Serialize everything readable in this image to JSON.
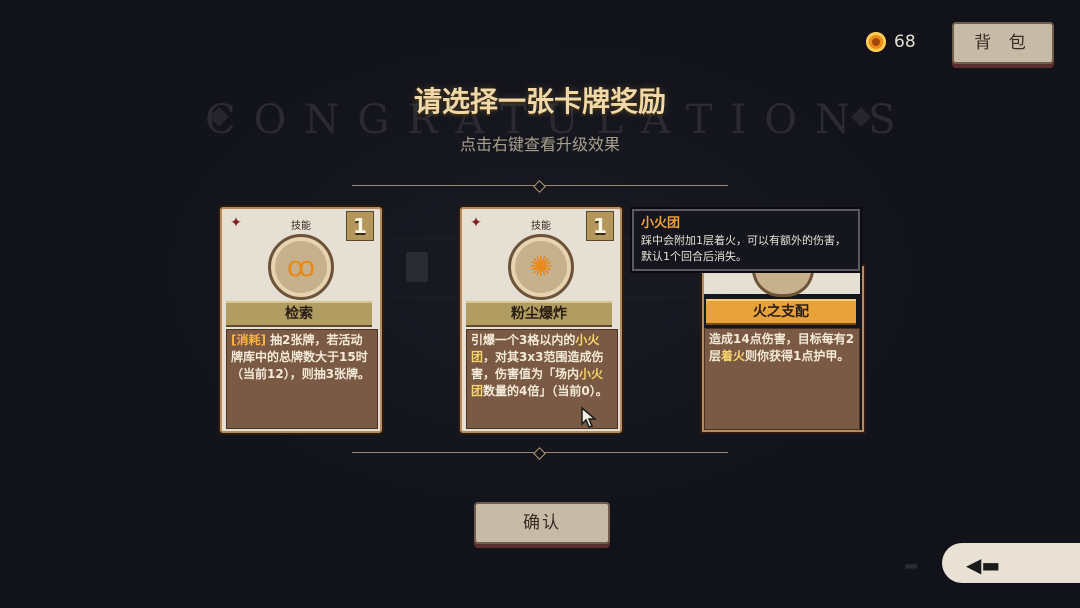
{
  "background": {
    "watermark": "CONGRATULATIONS"
  },
  "header": {
    "coin_count": "68",
    "bag_label": "背 包"
  },
  "title": "请选择一张卡牌奖励",
  "subtitle": "点击右键查看升级效果",
  "cards": [
    {
      "name": "检索",
      "type": "技能",
      "cost": "1",
      "icon": "squirrel-icon",
      "desc_parts": [
        {
          "text": "[消耗]",
          "hl": "orange"
        },
        {
          "text": " 抽2张牌，若活动牌库中的总牌数大于15时（当前12），则抽3张牌。",
          "hl": ""
        }
      ]
    },
    {
      "name": "粉尘爆炸",
      "type": "技能",
      "cost": "1",
      "icon": "explosion-icon",
      "desc_parts": [
        {
          "text": "引爆一个3格以内的",
          "hl": ""
        },
        {
          "text": "小火团",
          "hl": "yellow"
        },
        {
          "text": "，对其3x3范围造成伤害，伤害值为「场内",
          "hl": ""
        },
        {
          "text": "小火团",
          "hl": "yellow"
        },
        {
          "text": "数量的4倍」（当前0）。",
          "hl": ""
        }
      ]
    },
    {
      "name": "火之支配",
      "desc_parts": [
        {
          "text": "造成14点伤害，目标每有2层",
          "hl": ""
        },
        {
          "text": "着火",
          "hl": "yellow"
        },
        {
          "text": "则你获得1点护甲。",
          "hl": ""
        }
      ]
    }
  ],
  "tooltip": {
    "title": "小火团",
    "body": "踩中会附加1层着火，可以有额外的伤害，默认1个回合后消失。"
  },
  "confirm_label": "确认",
  "colors": {
    "background": "#11121a",
    "card_body": "#7a5a44",
    "accent_gold": "#f0d9a6",
    "highlight_orange": "#ffb347",
    "button": "#c7bba8"
  }
}
